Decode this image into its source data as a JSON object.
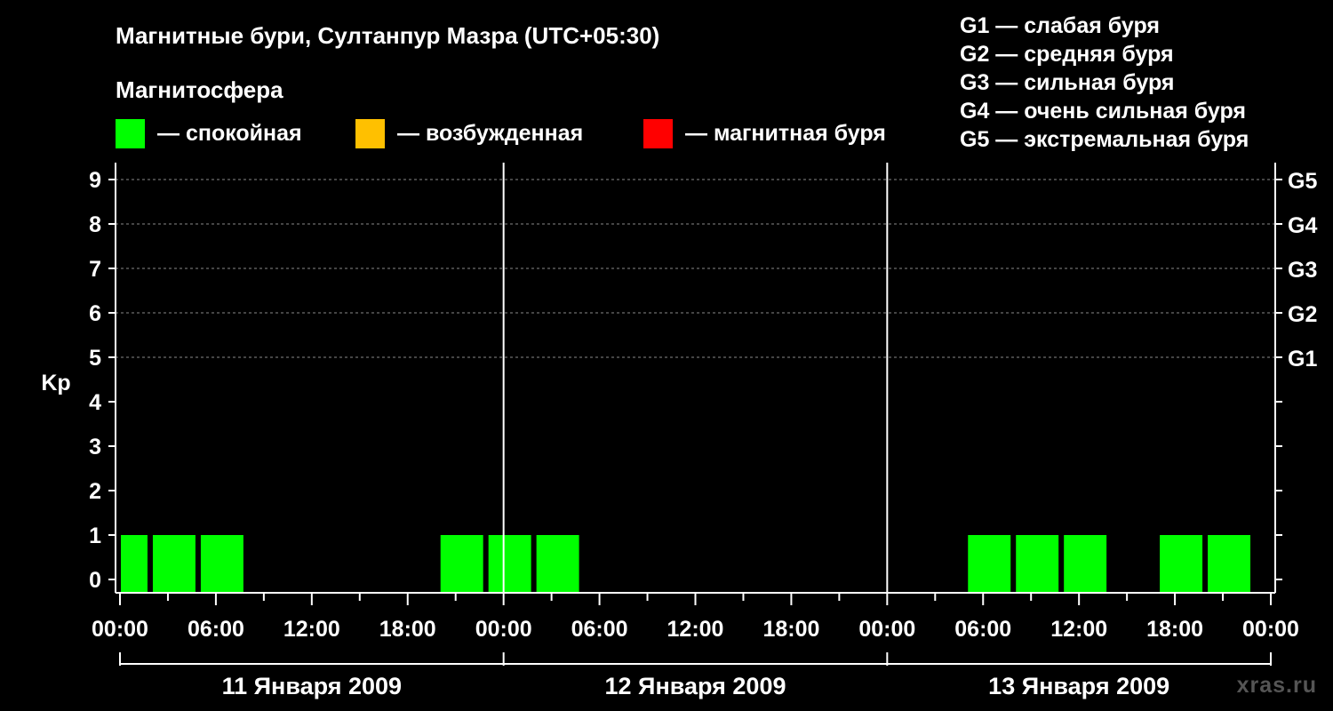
{
  "chart_data": {
    "type": "bar",
    "title": "Магнитные бури, Султанпур Мазра (UTC+05:30)",
    "subtitle": "Магнитосфера",
    "ylabel": "Kp",
    "ylim": [
      0,
      9
    ],
    "y_ticks": [
      "0",
      "1",
      "2",
      "3",
      "4",
      "5",
      "6",
      "7",
      "8",
      "9"
    ],
    "storm_levels": [
      {
        "kp": 5,
        "label": "G1"
      },
      {
        "kp": 6,
        "label": "G2"
      },
      {
        "kp": 7,
        "label": "G3"
      },
      {
        "kp": 8,
        "label": "G4"
      },
      {
        "kp": 9,
        "label": "G5"
      }
    ],
    "storm_legend": [
      "G1 — слабая буря",
      "G2 — средняя буря",
      "G3 — сильная буря",
      "G4 — очень сильная буря",
      "G5 — экстремальная буря"
    ],
    "state_legend": [
      {
        "label": "— спокойная",
        "color": "#00ff00"
      },
      {
        "label": "— возбужденная",
        "color": "#ffc000"
      },
      {
        "label": "— магнитная буря",
        "color": "#ff0000"
      }
    ],
    "x_ticks": [
      "00:00",
      "06:00",
      "12:00",
      "18:00",
      "00:00",
      "06:00",
      "12:00",
      "18:00",
      "00:00",
      "06:00",
      "12:00",
      "18:00",
      "00:00"
    ],
    "x_range_hours": [
      0,
      72
    ],
    "days": [
      "11 Января 2009",
      "12 Января 2009",
      "13 Января 2009"
    ],
    "bars": [
      {
        "start_hour": 0,
        "end_hour": 2,
        "kp": 1,
        "color": "#00ff00"
      },
      {
        "start_hour": 2,
        "end_hour": 5,
        "kp": 1,
        "color": "#00ff00"
      },
      {
        "start_hour": 5,
        "end_hour": 8,
        "kp": 1,
        "color": "#00ff00"
      },
      {
        "start_hour": 20,
        "end_hour": 23,
        "kp": 1,
        "color": "#00ff00"
      },
      {
        "start_hour": 23,
        "end_hour": 26,
        "kp": 1,
        "color": "#00ff00"
      },
      {
        "start_hour": 26,
        "end_hour": 29,
        "kp": 1,
        "color": "#00ff00"
      },
      {
        "start_hour": 53,
        "end_hour": 56,
        "kp": 1,
        "color": "#00ff00"
      },
      {
        "start_hour": 56,
        "end_hour": 59,
        "kp": 1,
        "color": "#00ff00"
      },
      {
        "start_hour": 59,
        "end_hour": 62,
        "kp": 1,
        "color": "#00ff00"
      },
      {
        "start_hour": 65,
        "end_hour": 68,
        "kp": 1,
        "color": "#00ff00"
      },
      {
        "start_hour": 68,
        "end_hour": 71,
        "kp": 1,
        "color": "#00ff00"
      }
    ],
    "grid_levels": [
      5,
      6,
      7,
      8,
      9
    ],
    "watermark": "xras.ru"
  }
}
